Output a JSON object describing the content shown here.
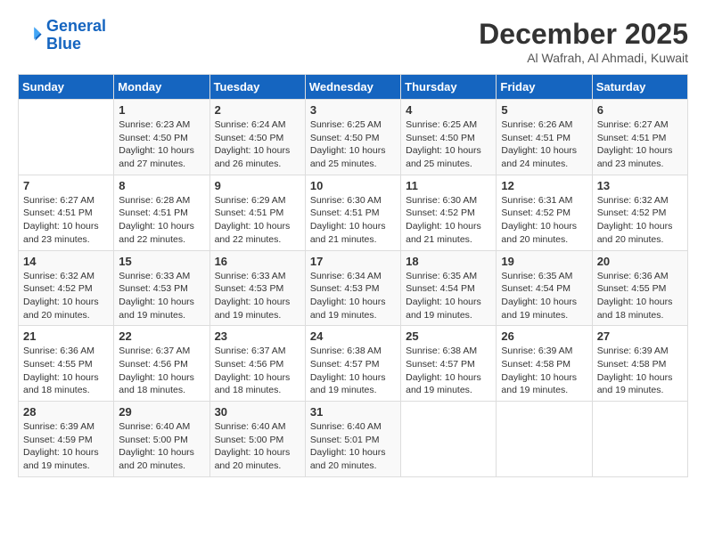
{
  "header": {
    "logo_line1": "General",
    "logo_line2": "Blue",
    "month": "December 2025",
    "location": "Al Wafrah, Al Ahmadi, Kuwait"
  },
  "days_of_week": [
    "Sunday",
    "Monday",
    "Tuesday",
    "Wednesday",
    "Thursday",
    "Friday",
    "Saturday"
  ],
  "weeks": [
    [
      {
        "day": "",
        "info": ""
      },
      {
        "day": "1",
        "info": "Sunrise: 6:23 AM\nSunset: 4:50 PM\nDaylight: 10 hours\nand 27 minutes."
      },
      {
        "day": "2",
        "info": "Sunrise: 6:24 AM\nSunset: 4:50 PM\nDaylight: 10 hours\nand 26 minutes."
      },
      {
        "day": "3",
        "info": "Sunrise: 6:25 AM\nSunset: 4:50 PM\nDaylight: 10 hours\nand 25 minutes."
      },
      {
        "day": "4",
        "info": "Sunrise: 6:25 AM\nSunset: 4:50 PM\nDaylight: 10 hours\nand 25 minutes."
      },
      {
        "day": "5",
        "info": "Sunrise: 6:26 AM\nSunset: 4:51 PM\nDaylight: 10 hours\nand 24 minutes."
      },
      {
        "day": "6",
        "info": "Sunrise: 6:27 AM\nSunset: 4:51 PM\nDaylight: 10 hours\nand 23 minutes."
      }
    ],
    [
      {
        "day": "7",
        "info": "Sunrise: 6:27 AM\nSunset: 4:51 PM\nDaylight: 10 hours\nand 23 minutes."
      },
      {
        "day": "8",
        "info": "Sunrise: 6:28 AM\nSunset: 4:51 PM\nDaylight: 10 hours\nand 22 minutes."
      },
      {
        "day": "9",
        "info": "Sunrise: 6:29 AM\nSunset: 4:51 PM\nDaylight: 10 hours\nand 22 minutes."
      },
      {
        "day": "10",
        "info": "Sunrise: 6:30 AM\nSunset: 4:51 PM\nDaylight: 10 hours\nand 21 minutes."
      },
      {
        "day": "11",
        "info": "Sunrise: 6:30 AM\nSunset: 4:52 PM\nDaylight: 10 hours\nand 21 minutes."
      },
      {
        "day": "12",
        "info": "Sunrise: 6:31 AM\nSunset: 4:52 PM\nDaylight: 10 hours\nand 20 minutes."
      },
      {
        "day": "13",
        "info": "Sunrise: 6:32 AM\nSunset: 4:52 PM\nDaylight: 10 hours\nand 20 minutes."
      }
    ],
    [
      {
        "day": "14",
        "info": "Sunrise: 6:32 AM\nSunset: 4:52 PM\nDaylight: 10 hours\nand 20 minutes."
      },
      {
        "day": "15",
        "info": "Sunrise: 6:33 AM\nSunset: 4:53 PM\nDaylight: 10 hours\nand 19 minutes."
      },
      {
        "day": "16",
        "info": "Sunrise: 6:33 AM\nSunset: 4:53 PM\nDaylight: 10 hours\nand 19 minutes."
      },
      {
        "day": "17",
        "info": "Sunrise: 6:34 AM\nSunset: 4:53 PM\nDaylight: 10 hours\nand 19 minutes."
      },
      {
        "day": "18",
        "info": "Sunrise: 6:35 AM\nSunset: 4:54 PM\nDaylight: 10 hours\nand 19 minutes."
      },
      {
        "day": "19",
        "info": "Sunrise: 6:35 AM\nSunset: 4:54 PM\nDaylight: 10 hours\nand 19 minutes."
      },
      {
        "day": "20",
        "info": "Sunrise: 6:36 AM\nSunset: 4:55 PM\nDaylight: 10 hours\nand 18 minutes."
      }
    ],
    [
      {
        "day": "21",
        "info": "Sunrise: 6:36 AM\nSunset: 4:55 PM\nDaylight: 10 hours\nand 18 minutes."
      },
      {
        "day": "22",
        "info": "Sunrise: 6:37 AM\nSunset: 4:56 PM\nDaylight: 10 hours\nand 18 minutes."
      },
      {
        "day": "23",
        "info": "Sunrise: 6:37 AM\nSunset: 4:56 PM\nDaylight: 10 hours\nand 18 minutes."
      },
      {
        "day": "24",
        "info": "Sunrise: 6:38 AM\nSunset: 4:57 PM\nDaylight: 10 hours\nand 19 minutes."
      },
      {
        "day": "25",
        "info": "Sunrise: 6:38 AM\nSunset: 4:57 PM\nDaylight: 10 hours\nand 19 minutes."
      },
      {
        "day": "26",
        "info": "Sunrise: 6:39 AM\nSunset: 4:58 PM\nDaylight: 10 hours\nand 19 minutes."
      },
      {
        "day": "27",
        "info": "Sunrise: 6:39 AM\nSunset: 4:58 PM\nDaylight: 10 hours\nand 19 minutes."
      }
    ],
    [
      {
        "day": "28",
        "info": "Sunrise: 6:39 AM\nSunset: 4:59 PM\nDaylight: 10 hours\nand 19 minutes."
      },
      {
        "day": "29",
        "info": "Sunrise: 6:40 AM\nSunset: 5:00 PM\nDaylight: 10 hours\nand 20 minutes."
      },
      {
        "day": "30",
        "info": "Sunrise: 6:40 AM\nSunset: 5:00 PM\nDaylight: 10 hours\nand 20 minutes."
      },
      {
        "day": "31",
        "info": "Sunrise: 6:40 AM\nSunset: 5:01 PM\nDaylight: 10 hours\nand 20 minutes."
      },
      {
        "day": "",
        "info": ""
      },
      {
        "day": "",
        "info": ""
      },
      {
        "day": "",
        "info": ""
      }
    ]
  ]
}
